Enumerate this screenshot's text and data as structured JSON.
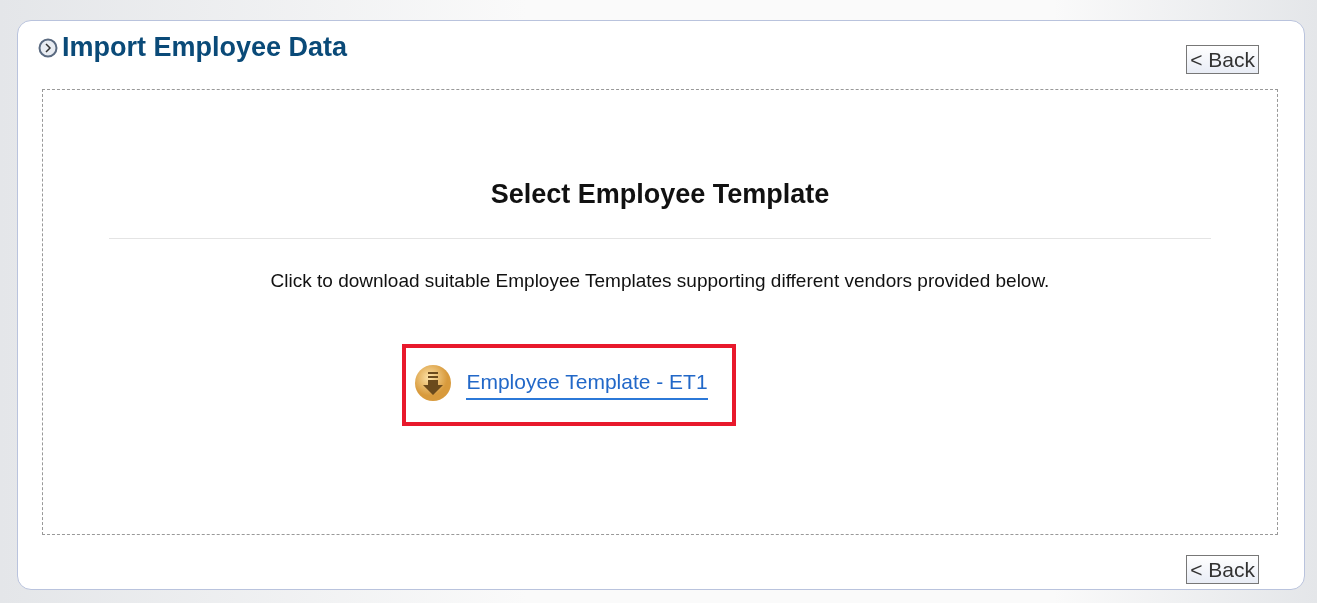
{
  "header": {
    "title": "Import Employee Data",
    "back_button": "< Back"
  },
  "content": {
    "heading": "Select Employee Template",
    "instruction": "Click to download suitable Employee Templates supporting different vendors provided below.",
    "templates": [
      {
        "label": "Employee Template - ET1",
        "highlighted": true
      }
    ]
  },
  "footer": {
    "back_button": "< Back"
  }
}
